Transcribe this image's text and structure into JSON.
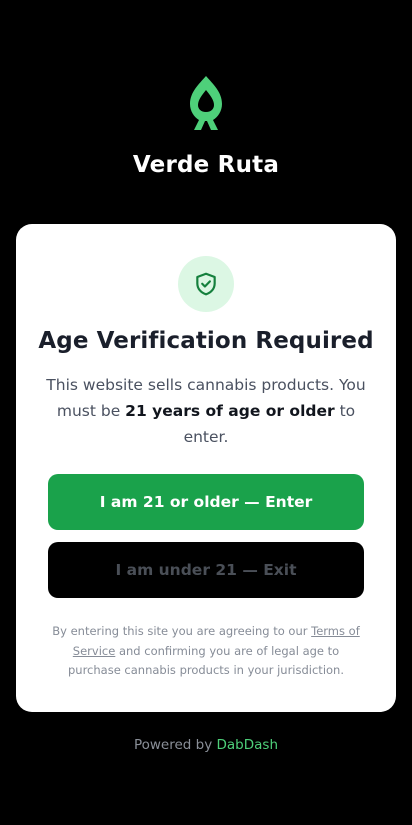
{
  "brand": {
    "name": "Verde Ruta",
    "logo_icon": "rocket-leaf-icon",
    "accent_color": "#4ed07a"
  },
  "card": {
    "badge_icon": "shield-check-icon",
    "title": "Age Verification Required",
    "desc_before": "This website sells cannabis products. You must be ",
    "desc_bold": "21 years of age or older",
    "desc_after": " to enter.",
    "enter_button": "I am 21 or older — Enter",
    "exit_button": "I am under 21 — Exit",
    "legal_before": "By entering this site you are agreeing to our ",
    "legal_link": "Terms of Service",
    "legal_after": " and confirming you are of legal age to purchase cannabis products in your jurisdiction."
  },
  "footer": {
    "powered_prefix": "Powered by ",
    "powered_link": "DabDash"
  },
  "colors": {
    "enter_button_bg": "#1aa24b",
    "exit_button_bg": "#000000",
    "badge_bg": "#dcf7e4"
  }
}
